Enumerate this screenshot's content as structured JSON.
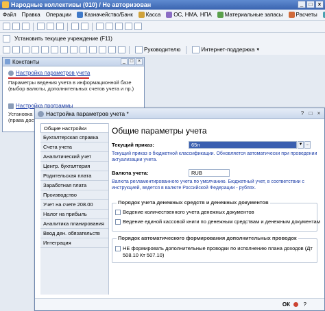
{
  "window": {
    "title": "Народные коллективы (010) / Не авторизован"
  },
  "menu": {
    "items": [
      {
        "label": "Файл",
        "color": ""
      },
      {
        "label": "Правка",
        "color": ""
      },
      {
        "label": "Операции",
        "color": ""
      },
      {
        "label": "Казначейство/Банк",
        "color": "#3f79c8"
      },
      {
        "label": "Касса",
        "color": "#d0a23a"
      },
      {
        "label": "ОС, НМА, НПА",
        "color": "#8a6cc4"
      },
      {
        "label": "Материальные запасы",
        "color": "#5aa04b"
      },
      {
        "label": "Расчеты",
        "color": "#d06a3a"
      },
      {
        "label": "Санкцио",
        "color": "#4aa0b0"
      }
    ]
  },
  "toolbar2": {
    "set_org_label": "Установить текущее учреждение (F11)"
  },
  "toolbar3": {
    "manager_label": "Руководителю",
    "support_label": "Интернет-поддержка"
  },
  "constants_window": {
    "title": "Константы",
    "link1": "Настройка параметров учета",
    "desc1": "Параметры ведения учета в информационной базе (выбор валюты, дополнительных счетов учета и пр.)",
    "link2": "Настройка программы",
    "desc2_line1": "Установка",
    "desc2_line2": "(права дост"
  },
  "settings_window": {
    "title": "Настройка параметров учета *",
    "nav": [
      "Общие настройки",
      "Бухгалтерская справка",
      "Счета учета",
      "Аналитический учет",
      "Центр. бухгалтерия",
      "Родительская плата",
      "Заработная плата",
      "Производство",
      "Учет на счете 208.00",
      "Налог на прибыль",
      "Аналитика планирования",
      "Ввод ден. обязательств",
      "Интеграция"
    ],
    "heading": "Общие параметры учета",
    "current_order_label": "Текущий приказ:",
    "current_order_value": "65н",
    "current_order_note": "Текущий приказ о бюджетной классификации. Обновляется автоматически при проведении актуализации учета.",
    "currency_label": "Валюта учета:",
    "currency_value": "RUB",
    "currency_note": "Валюта регламентированного учета по умолчанию. Бюджетный учет, в соответствии с инструкцией, ведется в валюте Российской Федерации - рублях.",
    "group1_title": "Порядок учета денежных средств и денежных документов",
    "group1_cb1": "Ведение количественного учета денежных документов",
    "group1_cb2": "Ведение единой кассовой книги по денежным средствам и денежным документам",
    "group2_title": "Порядок автоматического формирования дополнительных проводок",
    "group2_cb1_line1": "НЕ формировать дополнительные проводки по исполнению плана доходов (Дт",
    "group2_cb1_line2": "508.10 Кт 507.10)",
    "ok_label": "ОК",
    "cancel_label": "Отмена",
    "help_label": "?"
  }
}
